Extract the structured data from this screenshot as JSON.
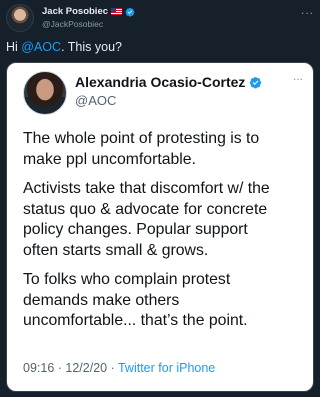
{
  "outer_tweet": {
    "display_name": "Jack Posobiec",
    "handle": "@JackPosobiec",
    "text_prefix": "Hi ",
    "mention": "@AOC",
    "text_suffix": ". This you?",
    "more_label": "..."
  },
  "quoted_tweet": {
    "display_name": "Alexandria Ocasio-Cortez",
    "handle": "@AOC",
    "more_label": "...",
    "paragraphs": [
      "The whole point of protesting is to\nmake ppl uncomfortable.",
      "Activists take that discomfort w/ the\nstatus quo & advocate for concrete\npolicy changes. Popular support\noften starts small & grows.",
      "To folks who complain protest\ndemands make others\nuncomfortable... that’s the point."
    ],
    "timestamp": "09:16 · 12/2/20 · ",
    "source": "Twitter for iPhone"
  },
  "colors": {
    "background": "#15202b",
    "link": "#1d9bf0",
    "verified": "#1d9bf0"
  },
  "icons": {
    "flag": "us-flag-icon",
    "verified": "verified-badge-icon",
    "more": "more-horizontal-icon"
  }
}
